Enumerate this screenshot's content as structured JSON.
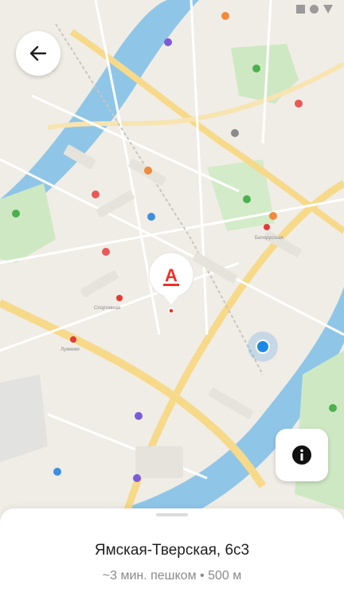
{
  "address": {
    "title": "Ямская-Тверская, 6с3",
    "walk_time": "~3 мин. пешком",
    "separator": "•",
    "distance": "500 м"
  },
  "map": {
    "pin_letter": "А",
    "brand_color": "#ef3124",
    "user_dot_color": "#1e88e5",
    "labels": {
      "metro_belorusskaya": "Белорусская",
      "metro_sportivnaya": "Спортивная",
      "metro_luzhniki": "Лужники"
    }
  },
  "icons": {
    "back": "arrow-left-icon",
    "info": "info-icon"
  }
}
